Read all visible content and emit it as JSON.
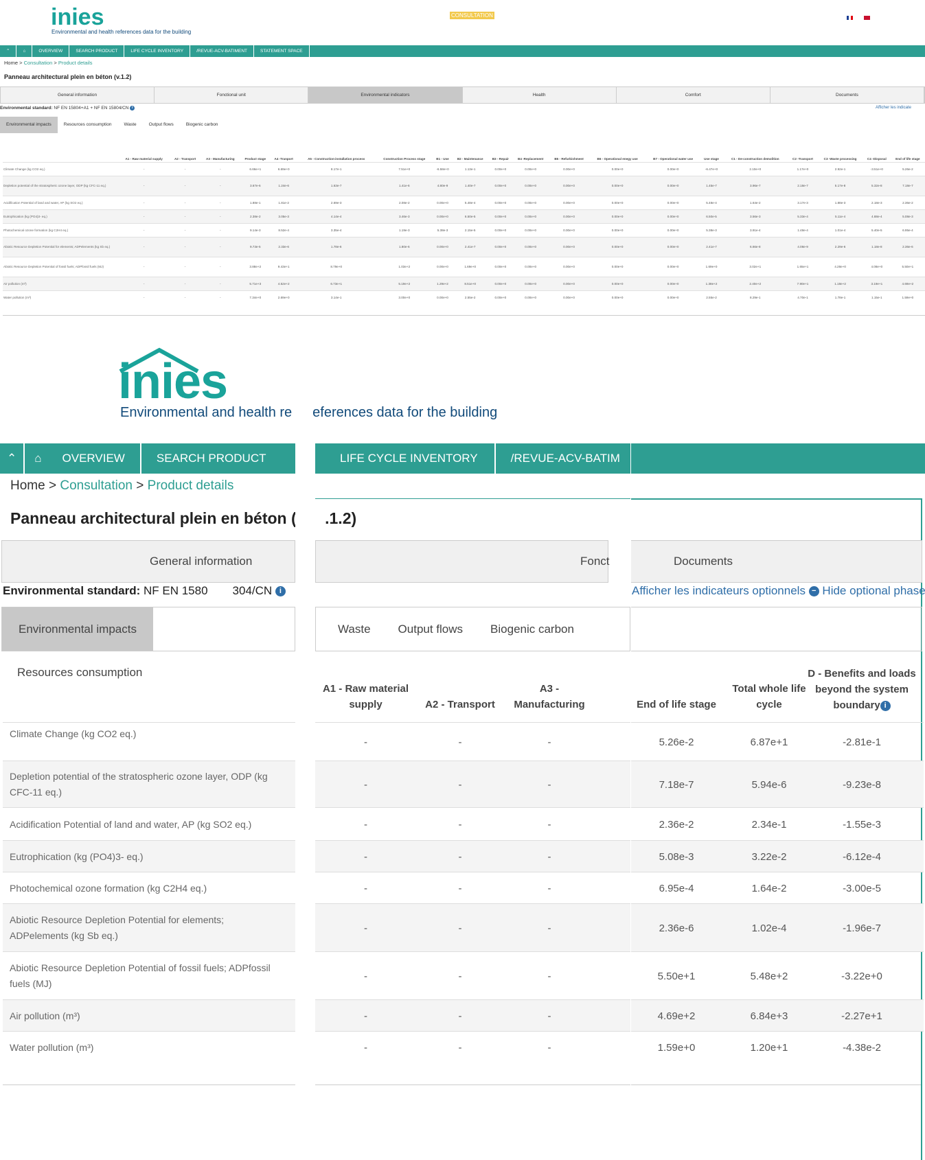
{
  "brand": {
    "logo": "inies",
    "tagline": "Environmental and health references data for the building",
    "tagline_part1": "Environmental and health re",
    "tagline_part2": "eferences data for the building"
  },
  "header": {
    "badge": "CONSULTATION"
  },
  "nav": {
    "items": [
      "OVERVIEW",
      "SEARCH PRODUCT",
      "LIFE CYCLE INVENTORY",
      "/REVUE-ACV-BATIMENT",
      "STATEMENT SPACE"
    ],
    "large_items": [
      "OVERVIEW",
      "SEARCH PRODUCT",
      "LIFE CYCLE INVENTORY",
      "/REVUE-ACV-BATIM"
    ]
  },
  "breadcrumb": {
    "home": "Home",
    "sep": ">",
    "consultation": "Consultation",
    "current": "Product details"
  },
  "product": {
    "title": "Panneau architectural plein en béton (v.1.2)",
    "title_part1": "Panneau architectural plein en béton (v.",
    "title_part2": ".1.2)"
  },
  "tabs": [
    "General information",
    "Fonctional unit",
    "Environmental indicators",
    "Health",
    "Comfort",
    "Documents"
  ],
  "large_tabs": {
    "general": "General information",
    "fonct": "Fonct",
    "documents": "Documents"
  },
  "standard": {
    "label": "Environmental standard:",
    "value": "NF EN 15804+A1 + NF EN 15804/CN",
    "large_value1": "NF EN 1580",
    "large_value2": "304/CN",
    "optional": "Afficher les indicateurs optionnels",
    "hide": "Hide optional phases",
    "small_optional": "Afficher les indicate"
  },
  "subtabs": [
    "Environmental impacts",
    "Resources consumption",
    "Waste",
    "Output flows",
    "Biogenic carbon"
  ],
  "small_table": {
    "headers": [
      "",
      "A1 - Raw material supply",
      "A2 - Transport",
      "A3 - Manufacturing",
      "Product stage",
      "A4 -Tranport",
      "A5 - Construction-installation process",
      "Construction Process stage",
      "B1 - Use",
      "B2 - Maintenance",
      "B3 - Repair",
      "B4 -Replacement",
      "B5 - Refurbishment",
      "B6 - Operational enegy use",
      "B7 - Operational water use",
      "Use stage",
      "C1 - De-construction demolition",
      "C2 -Transport",
      "C3 -Waste processing",
      "C4 -Disposal",
      "End of life stage"
    ],
    "rows": [
      [
        "Climate Change (kg CO2 eq.)",
        "-",
        "-",
        "-",
        "6.66e+1",
        "6.69e+0",
        "8.17e-1",
        "7.51e+0",
        "-6.58e+0",
        "1.13e-1",
        "0.00e+0",
        "0.00e+0",
        "0.00e+0",
        "0.00e+0",
        "0.00e+0",
        "-6.47e+0",
        "2.10e+0",
        "1.17e+0",
        "2.92e-1",
        "-3.51e+0",
        "5.26e-2"
      ],
      [
        "Depletion potential of the stratospheric ozone layer, ODP (kg CFC-11 eq.)",
        "-",
        "-",
        "-",
        "3.67e-6",
        "1.24e-6",
        "1.63e-7",
        "1.41e-6",
        "4.80e-9",
        "1.40e-7",
        "0.00e+0",
        "0.00e+0",
        "0.00e+0",
        "0.00e+0",
        "0.00e+0",
        "1.45e-7",
        "3.96e-7",
        "2.18e-7",
        "5.17e-8",
        "5.32e-8",
        "7.18e-7"
      ],
      [
        "Acidification Potential of land and water, AP (kg SO2 eq.)",
        "-",
        "-",
        "-",
        "1.88e-1",
        "1.81e-2",
        "2.69e-3",
        "2.08e-2",
        "0.00e+0",
        "5.48e-4",
        "0.00e+0",
        "0.00e+0",
        "0.00e+0",
        "0.00e+0",
        "0.00e+0",
        "5.48e-4",
        "1.64e-2",
        "3.17e-3",
        "1.88e-3",
        "2.18e-3",
        "2.36e-2"
      ],
      [
        "Eutrophication (kg (PO4)3- eq.)",
        "-",
        "-",
        "-",
        "2.38e-2",
        "3.05e-3",
        "4.14e-4",
        "3.46e-3",
        "0.00e+0",
        "6.50e-5",
        "0.00e+0",
        "0.00e+0",
        "0.00e+0",
        "0.00e+0",
        "0.00e+0",
        "6.50e-5",
        "3.56e-3",
        "5.33e-4",
        "5.11e-4",
        "4.88e-4",
        "5.08e-3"
      ],
      [
        "Photochemical ozone formation (kg C2H4 eq.)",
        "-",
        "-",
        "-",
        "9.14e-3",
        "8.52e-4",
        "3.35e-4",
        "1.19e-3",
        "5.38e-3",
        "2.15e-5",
        "0.00e+0",
        "0.00e+0",
        "0.00e+0",
        "0.00e+0",
        "0.00e+0",
        "5.38e-3",
        "3.91e-4",
        "1.48e-4",
        "1.01e-4",
        "5.40e-5",
        "6.95e-4"
      ],
      [
        "Abiotic Resource Depletion Potential for elements; ADPelements (kg Sb eq.)",
        "-",
        "-",
        "-",
        "9.73e-5",
        "2.33e-6",
        "1.78e-6",
        "1.80e-6",
        "0.00e+0",
        "2.41e-7",
        "0.00e+0",
        "0.00e+0",
        "0.00e+0",
        "0.00e+0",
        "0.00e+0",
        "2.41e-7",
        "6.66e-8",
        "4.08e-9",
        "2.29e-6",
        "1.18e-8",
        "2.36e-6"
      ],
      [
        "Abiotic Resource Depletion Potential of fossil fuels; ADPfossil fuels (MJ)",
        "-",
        "-",
        "-",
        "3.88e+2",
        "9.43e+1",
        "8.79e+0",
        "1.03e+2",
        "0.00e+0",
        "1.69e+0",
        "0.00e+0",
        "0.00e+0",
        "0.00e+0",
        "0.00e+0",
        "0.00e+0",
        "1.69e+0",
        "3.02e+1",
        "1.65e+1",
        "4.28e+0",
        "4.08e+0",
        "5.50e+1"
      ],
      [
        "Air pollution (m³)",
        "-",
        "-",
        "-",
        "5.71e+3",
        "4.52e+2",
        "6.73e+1",
        "5.19e+2",
        "1.29e+2",
        "8.51e+0",
        "0.00e+0",
        "0.00e+0",
        "0.00e+0",
        "0.00e+0",
        "0.00e+0",
        "1.38e+2",
        "2.40e+2",
        "7.90e+1",
        "1.18e+2",
        "3.19e+1",
        "4.69e+2"
      ],
      [
        "Water pollution (m³)",
        "-",
        "-",
        "-",
        "7.34e+0",
        "2.69e+0",
        "3.14e-1",
        "3.00e+0",
        "0.00e+0",
        "2.55e-2",
        "0.00e+0",
        "0.00e+0",
        "0.00e+0",
        "0.00e+0",
        "0.00e+0",
        "2.55e-2",
        "8.29e-1",
        "4.70e-1",
        "1.78e-1",
        "1.15e-1",
        "1.59e+0"
      ]
    ]
  },
  "large_table": {
    "headers": {
      "a1": "A1 - Raw material supply",
      "a2": "A2 - Transport",
      "a3": "A3 - Manufacturing",
      "eol": "End of life stage",
      "total": "Total whole life cycle",
      "d": "D - Benefits and loads beyond the system boundary"
    },
    "rows": [
      {
        "label": "Climate Change (kg CO2 eq.)",
        "a1": "-",
        "a2": "-",
        "a3": "-",
        "eol": "5.26e-2",
        "total": "6.87e+1",
        "d": "-2.81e-1"
      },
      {
        "label": "Depletion potential of the stratospheric ozone layer, ODP (kg CFC-11 eq.)",
        "a1": "-",
        "a2": "-",
        "a3": "-",
        "eol": "7.18e-7",
        "total": "5.94e-6",
        "d": "-9.23e-8"
      },
      {
        "label": "Acidification Potential of land and water, AP (kg SO2 eq.)",
        "a1": "-",
        "a2": "-",
        "a3": "-",
        "eol": "2.36e-2",
        "total": "2.34e-1",
        "d": "-1.55e-3"
      },
      {
        "label": "Eutrophication (kg (PO4)3- eq.)",
        "a1": "-",
        "a2": "-",
        "a3": "-",
        "eol": "5.08e-3",
        "total": "3.22e-2",
        "d": "-6.12e-4"
      },
      {
        "label": "Photochemical ozone formation (kg C2H4 eq.)",
        "a1": "-",
        "a2": "-",
        "a3": "-",
        "eol": "6.95e-4",
        "total": "1.64e-2",
        "d": "-3.00e-5"
      },
      {
        "label": "Abiotic Resource Depletion Potential for elements; ADPelements (kg Sb eq.)",
        "a1": "-",
        "a2": "-",
        "a3": "-",
        "eol": "2.36e-6",
        "total": "1.02e-4",
        "d": "-1.96e-7"
      },
      {
        "label": "Abiotic Resource Depletion Potential of fossil fuels; ADPfossil fuels (MJ)",
        "a1": "-",
        "a2": "-",
        "a3": "-",
        "eol": "5.50e+1",
        "total": "5.48e+2",
        "d": "-3.22e+0"
      },
      {
        "label": "Air pollution (m³)",
        "a1": "-",
        "a2": "-",
        "a3": "-",
        "eol": "4.69e+2",
        "total": "6.84e+3",
        "d": "-2.27e+1"
      },
      {
        "label": "Water pollution (m³)",
        "a1": "-",
        "a2": "-",
        "a3": "-",
        "eol": "1.59e+0",
        "total": "1.20e+1",
        "d": "-4.38e-2"
      }
    ]
  },
  "colors": {
    "teal": "#2e9e92",
    "navy": "#114a7a",
    "link_blue": "#2f6ea8",
    "badge": "#f2c94c"
  }
}
